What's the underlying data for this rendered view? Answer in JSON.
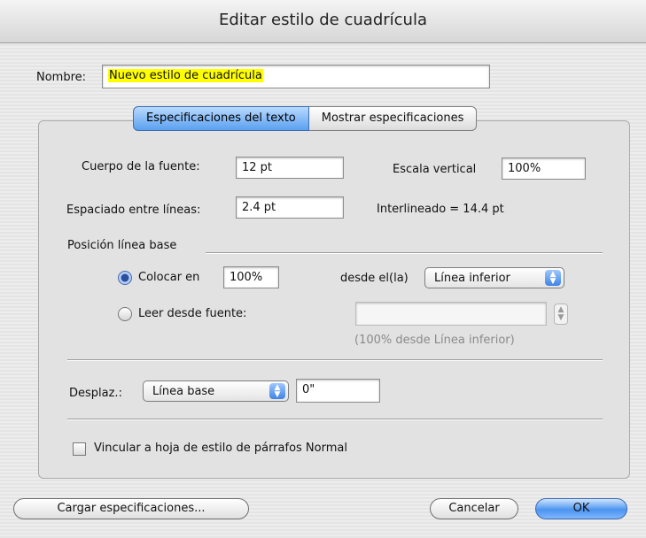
{
  "window": {
    "title": "Editar estilo de cuadrícula"
  },
  "name_field": {
    "label": "Nombre:",
    "value": "Nuevo estilo de cuadrícula"
  },
  "tabs": [
    {
      "label": "Especificaciones del texto",
      "active": true
    },
    {
      "label": "Mostrar especificaciones",
      "active": false
    }
  ],
  "font_size": {
    "label": "Cuerpo de la fuente:",
    "value": "12 pt"
  },
  "vertical_scale": {
    "label": "Escala vertical",
    "value": "100%"
  },
  "line_spacing": {
    "label": "Espaciado entre líneas:",
    "value": "2.4 pt"
  },
  "leading_text": "Interlineado = 14.4 pt",
  "baseline": {
    "section_label": "Posición línea base",
    "place_radio": {
      "label": "Colocar en",
      "value": "100%",
      "selected": true
    },
    "from_label": "desde el(la)",
    "from_popup": "Línea inferior",
    "read_radio": {
      "label": "Leer desde fuente:",
      "selected": false
    },
    "read_value": "",
    "hint": "(100% desde Línea inferior)"
  },
  "offset": {
    "label": "Desplaz.:",
    "popup": "Línea base",
    "value": "0\""
  },
  "link_checkbox": {
    "label": "Vincular a hoja de estilo de párrafos Normal",
    "checked": false
  },
  "buttons": {
    "load": "Cargar especificaciones...",
    "cancel": "Cancelar",
    "ok": "OK"
  },
  "colors": {
    "accent": "#4b94ef",
    "highlight": "#ffff00"
  }
}
